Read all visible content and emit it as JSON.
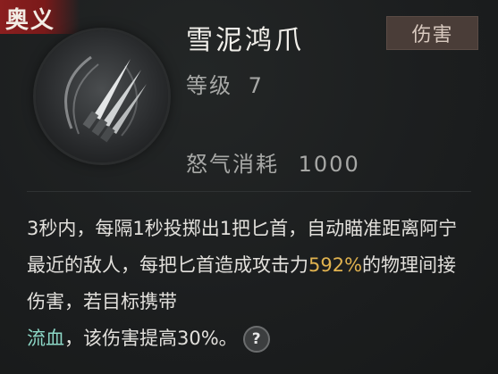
{
  "tag": {
    "label": "奥义"
  },
  "skill": {
    "name": "雪泥鸿爪",
    "type": "伤害",
    "level_label": "等级",
    "level": "7",
    "cost_label": "怒气消耗",
    "cost": "1000"
  },
  "description": {
    "p1": "3秒内，每隔1秒投掷出1把匕首，自动瞄准距离阿宁最近的敌人，每把匕首造成攻击力",
    "percent": "592%",
    "p2": "的物理间接伤害，若目标携带",
    "status": "流血",
    "p3": "，该伤害提高30%。",
    "help": "?"
  },
  "colors": {
    "tag_bg": "#8a1f1f",
    "highlight_value": "#e0b24f",
    "highlight_status": "#8cd7c6",
    "badge_bg": "#4a3d38"
  },
  "icons": {
    "skill": "thrown-daggers-icon",
    "help": "question-mark-icon"
  }
}
